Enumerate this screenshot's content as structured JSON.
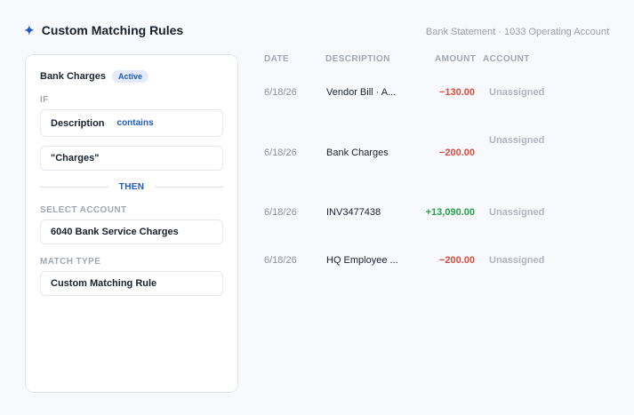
{
  "header": {
    "title": "Custom Matching Rules",
    "icon": "sparkle-icon",
    "meta": "Bank Statement · 1033 Operating Account"
  },
  "rule": {
    "name": "Bank Charges",
    "status": "Active",
    "if_label": "IF",
    "condition_field": "Description",
    "condition_operator": "contains",
    "condition_value": "\"Charges\"",
    "then_label": "THEN",
    "select_account_label": "SELECT ACCOUNT",
    "account_value": "6040 Bank Service Charges",
    "match_type_label": "MATCH TYPE",
    "match_type_value": "Custom Matching Rule"
  },
  "table": {
    "columns": [
      "DATE",
      "DESCRIPTION",
      "AMOUNT",
      "ACCOUNT"
    ],
    "rows": [
      {
        "date": "6/18/26",
        "description": "Vendor Bill · A...",
        "amount": "−130.00",
        "account": "Unassigned"
      },
      {
        "date": "6/18/26",
        "description": "Bank Charges",
        "amount": "−200.00",
        "account": "Unassigned"
      },
      {
        "date": "6/18/26",
        "description": "INV3477438",
        "amount": "+13,090.00",
        "account": "Unassigned"
      },
      {
        "date": "6/18/26",
        "description": "HQ Employee ...",
        "amount": "−200.00",
        "account": "Unassigned"
      }
    ]
  },
  "colors": {
    "accent": "#1f58c7",
    "negative": "#e04a3a",
    "positive": "#25a04a"
  }
}
